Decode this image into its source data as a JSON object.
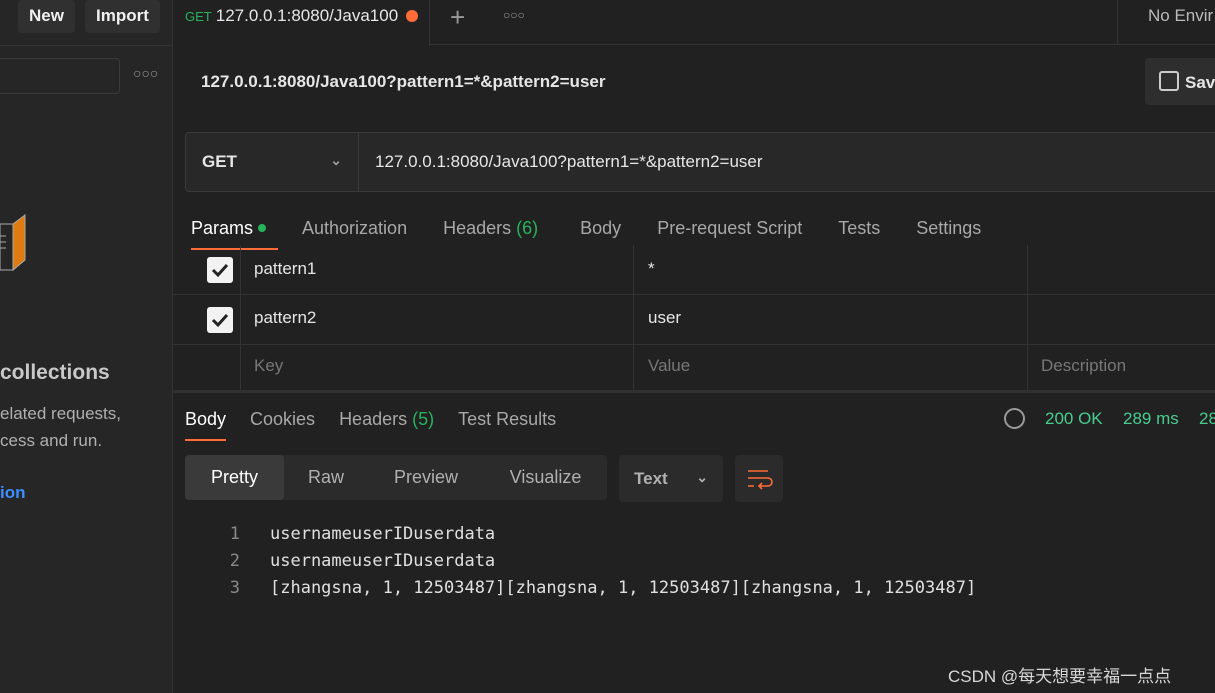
{
  "sidebar": {
    "new_label": "New",
    "import_label": "Import",
    "more_icon": "ellipsis-icon",
    "heading": "collections",
    "desc_line1": "elated requests,",
    "desc_line2": "cess and run.",
    "link": "ion"
  },
  "tab": {
    "method": "GET",
    "title": "127.0.0.1:8080/Java100",
    "unsaved_color": "#ff6c37"
  },
  "environment": "No Envir",
  "request": {
    "name": "127.0.0.1:8080/Java100?pattern1=*&pattern2=user",
    "save_label": "Sav",
    "method": "GET",
    "url": "127.0.0.1:8080/Java100?pattern1=*&pattern2=user"
  },
  "req_tabs": [
    {
      "label": "Params"
    },
    {
      "label": "Authorization"
    },
    {
      "label": "Headers",
      "count": "(6)"
    },
    {
      "label": "Body"
    },
    {
      "label": "Pre-request Script"
    },
    {
      "label": "Tests"
    },
    {
      "label": "Settings"
    }
  ],
  "params": [
    {
      "key": "pattern1",
      "value": "*",
      "checked": true
    },
    {
      "key": "pattern2",
      "value": "user",
      "checked": true
    }
  ],
  "param_placeholders": {
    "key": "Key",
    "value": "Value",
    "description": "Description"
  },
  "resp_tabs": [
    {
      "label": "Body"
    },
    {
      "label": "Cookies"
    },
    {
      "label": "Headers",
      "count": "(5)"
    },
    {
      "label": "Test Results"
    }
  ],
  "status": {
    "code": "200 OK",
    "time": "289 ms",
    "size": "28",
    "color": "#49cc90"
  },
  "view_modes": [
    "Pretty",
    "Raw",
    "Preview",
    "Visualize"
  ],
  "format": "Text",
  "body_lines": [
    "usernameuserIDuserdata",
    "usernameuserIDuserdata",
    "[zhangsna, 1, 12503487][zhangsna, 1, 12503487][zhangsna, 1, 12503487]"
  ],
  "watermark": "CSDN @每天想要幸福一点点"
}
